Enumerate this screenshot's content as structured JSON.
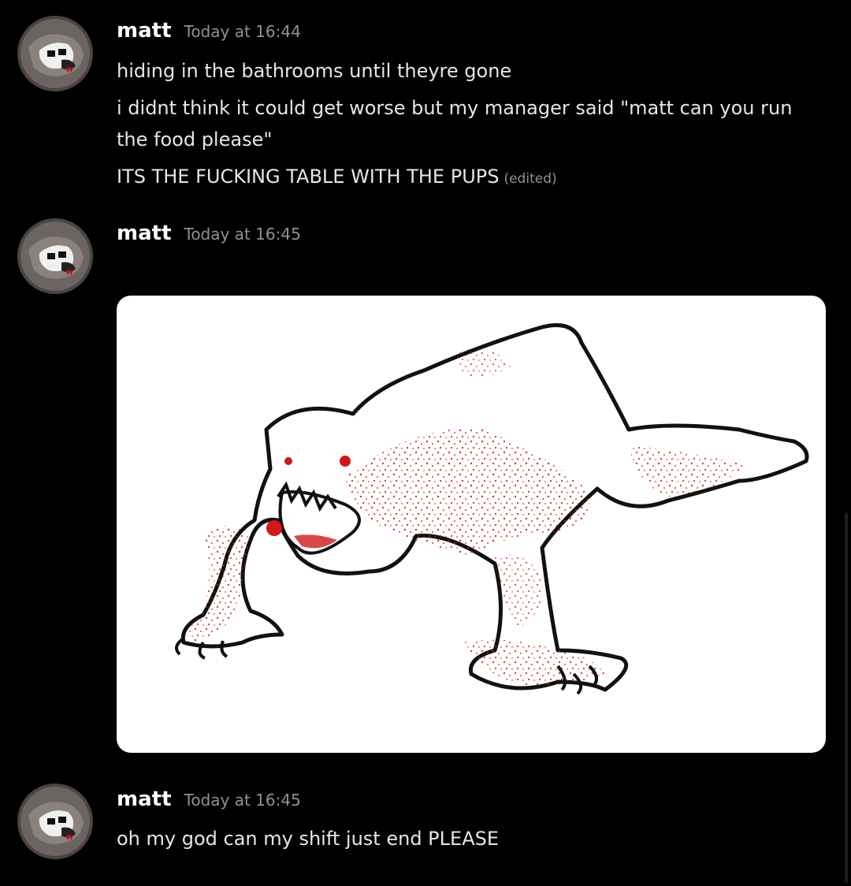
{
  "messages": [
    {
      "author": "matt",
      "timestamp": "Today at 16:44",
      "lines": [
        "hiding in the bathrooms until theyre gone",
        "i didnt think it could get worse but my manager said \"matt can you run the food please\"",
        "ITS THE FUCKING TABLE WITH THE PUPS"
      ],
      "edited_label": "(edited)"
    },
    {
      "author": "matt",
      "timestamp": "Today at 16:45",
      "attachment": {
        "icon": "monster-drawing-image",
        "background": "#ffffff"
      }
    },
    {
      "author": "matt",
      "timestamp": "Today at 16:45",
      "lines": [
        "oh my god can my shift just end PLEASE"
      ]
    }
  ],
  "colors": {
    "background": "#000000",
    "username": "#ffffff",
    "timestamp": "#8e9297",
    "text": "#dcddde",
    "blood": "#d01818"
  }
}
